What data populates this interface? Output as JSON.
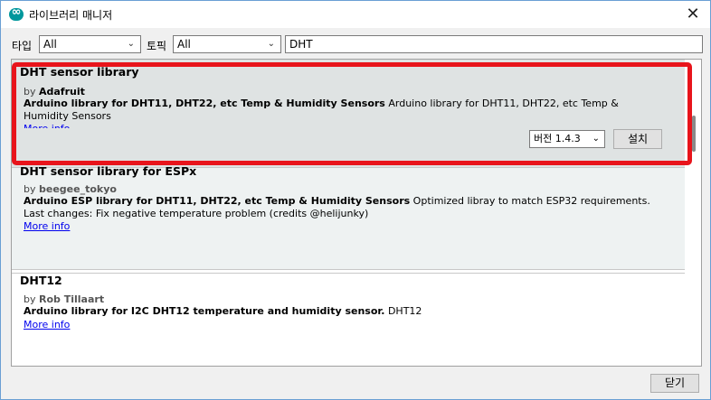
{
  "window": {
    "title": "라이브러리 매니저"
  },
  "filters": {
    "type_label": "타입",
    "type_value": "All",
    "topic_label": "토픽",
    "topic_value": "All",
    "search_value": "DHT"
  },
  "libraries": [
    {
      "name": "DHT sensor library",
      "by_prefix": "by",
      "author": "Adafruit",
      "desc_bold": "Arduino library for DHT11, DHT22, etc Temp & Humidity Sensors",
      "desc_rest": " Arduino library for DHT11, DHT22, etc Temp & Humidity Sensors",
      "more_info": "More info",
      "version_label": "버전 1.4.3",
      "install_label": "설치"
    },
    {
      "name": "DHT sensor library for ESPx",
      "by_prefix": "by",
      "author": "beegee_tokyo",
      "desc_bold": "Arduino ESP library for DHT11, DHT22, etc Temp & Humidity Sensors",
      "desc_rest": " Optimized libray to match ESP32 requirements. Last changes: Fix negative temperature problem (credits @helijunky)",
      "more_info": "More info"
    },
    {
      "name": "DHT12",
      "by_prefix": "by",
      "author": "Rob Tillaart",
      "desc_bold": "Arduino library for I2C DHT12 temperature and humidity sensor.",
      "desc_rest": " DHT12",
      "more_info": "More info"
    }
  ],
  "footer": {
    "close_label": "닫기"
  },
  "colors": {
    "highlight": "#e8141b",
    "link": "#0000ee",
    "selected_row": "#dfe3e3"
  }
}
